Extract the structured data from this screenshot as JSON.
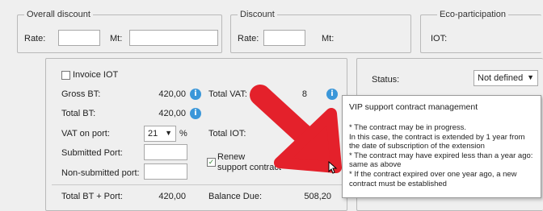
{
  "overall_discount": {
    "legend": "Overall discount",
    "rate_label": "Rate:",
    "mt_label": "Mt:"
  },
  "discount": {
    "legend": "Discount",
    "rate_label": "Rate:",
    "mt_label": "Mt:"
  },
  "eco": {
    "legend": "Eco-participation",
    "iot_label": "IOT:"
  },
  "totals": {
    "invoice_iot_label": "Invoice IOT",
    "gross_bt_label": "Gross BT:",
    "gross_bt_value": "420,00",
    "total_bt_label": "Total BT:",
    "total_bt_value": "420,00",
    "vat_on_port_label": "VAT on port:",
    "vat_on_port_value": "21",
    "percent_sign": "%",
    "submitted_port_label": "Submitted Port:",
    "non_submitted_port_label": "Non-submitted port:",
    "total_vat_label": "Total VAT:",
    "total_vat_value": "8",
    "total_iot_label": "Total IOT:",
    "renew_label_1": "Renew",
    "renew_label_2": "support contract",
    "total_bt_port_label": "Total BT + Port:",
    "total_bt_port_value": "420,00",
    "balance_due_label": "Balance Due:",
    "balance_due_value": "508,20"
  },
  "status": {
    "label": "Status:",
    "value": "Not defined"
  },
  "tooltip": {
    "title": "VIP support contract management",
    "line1": "* The contract may be in progress.",
    "line2": "In this case, the contract is extended by 1 year from the date of subscription of the extension",
    "line3": "* The contract may have expired less than a year ago: same as above",
    "line4": "* If the contract expired over one year ago, a new contract must be established"
  },
  "icons": {
    "info": "i",
    "dropdown": "▼",
    "checkmark": "✓"
  },
  "colors": {
    "info_blue": "#3b97d9",
    "arrow_red": "#e4212b"
  }
}
